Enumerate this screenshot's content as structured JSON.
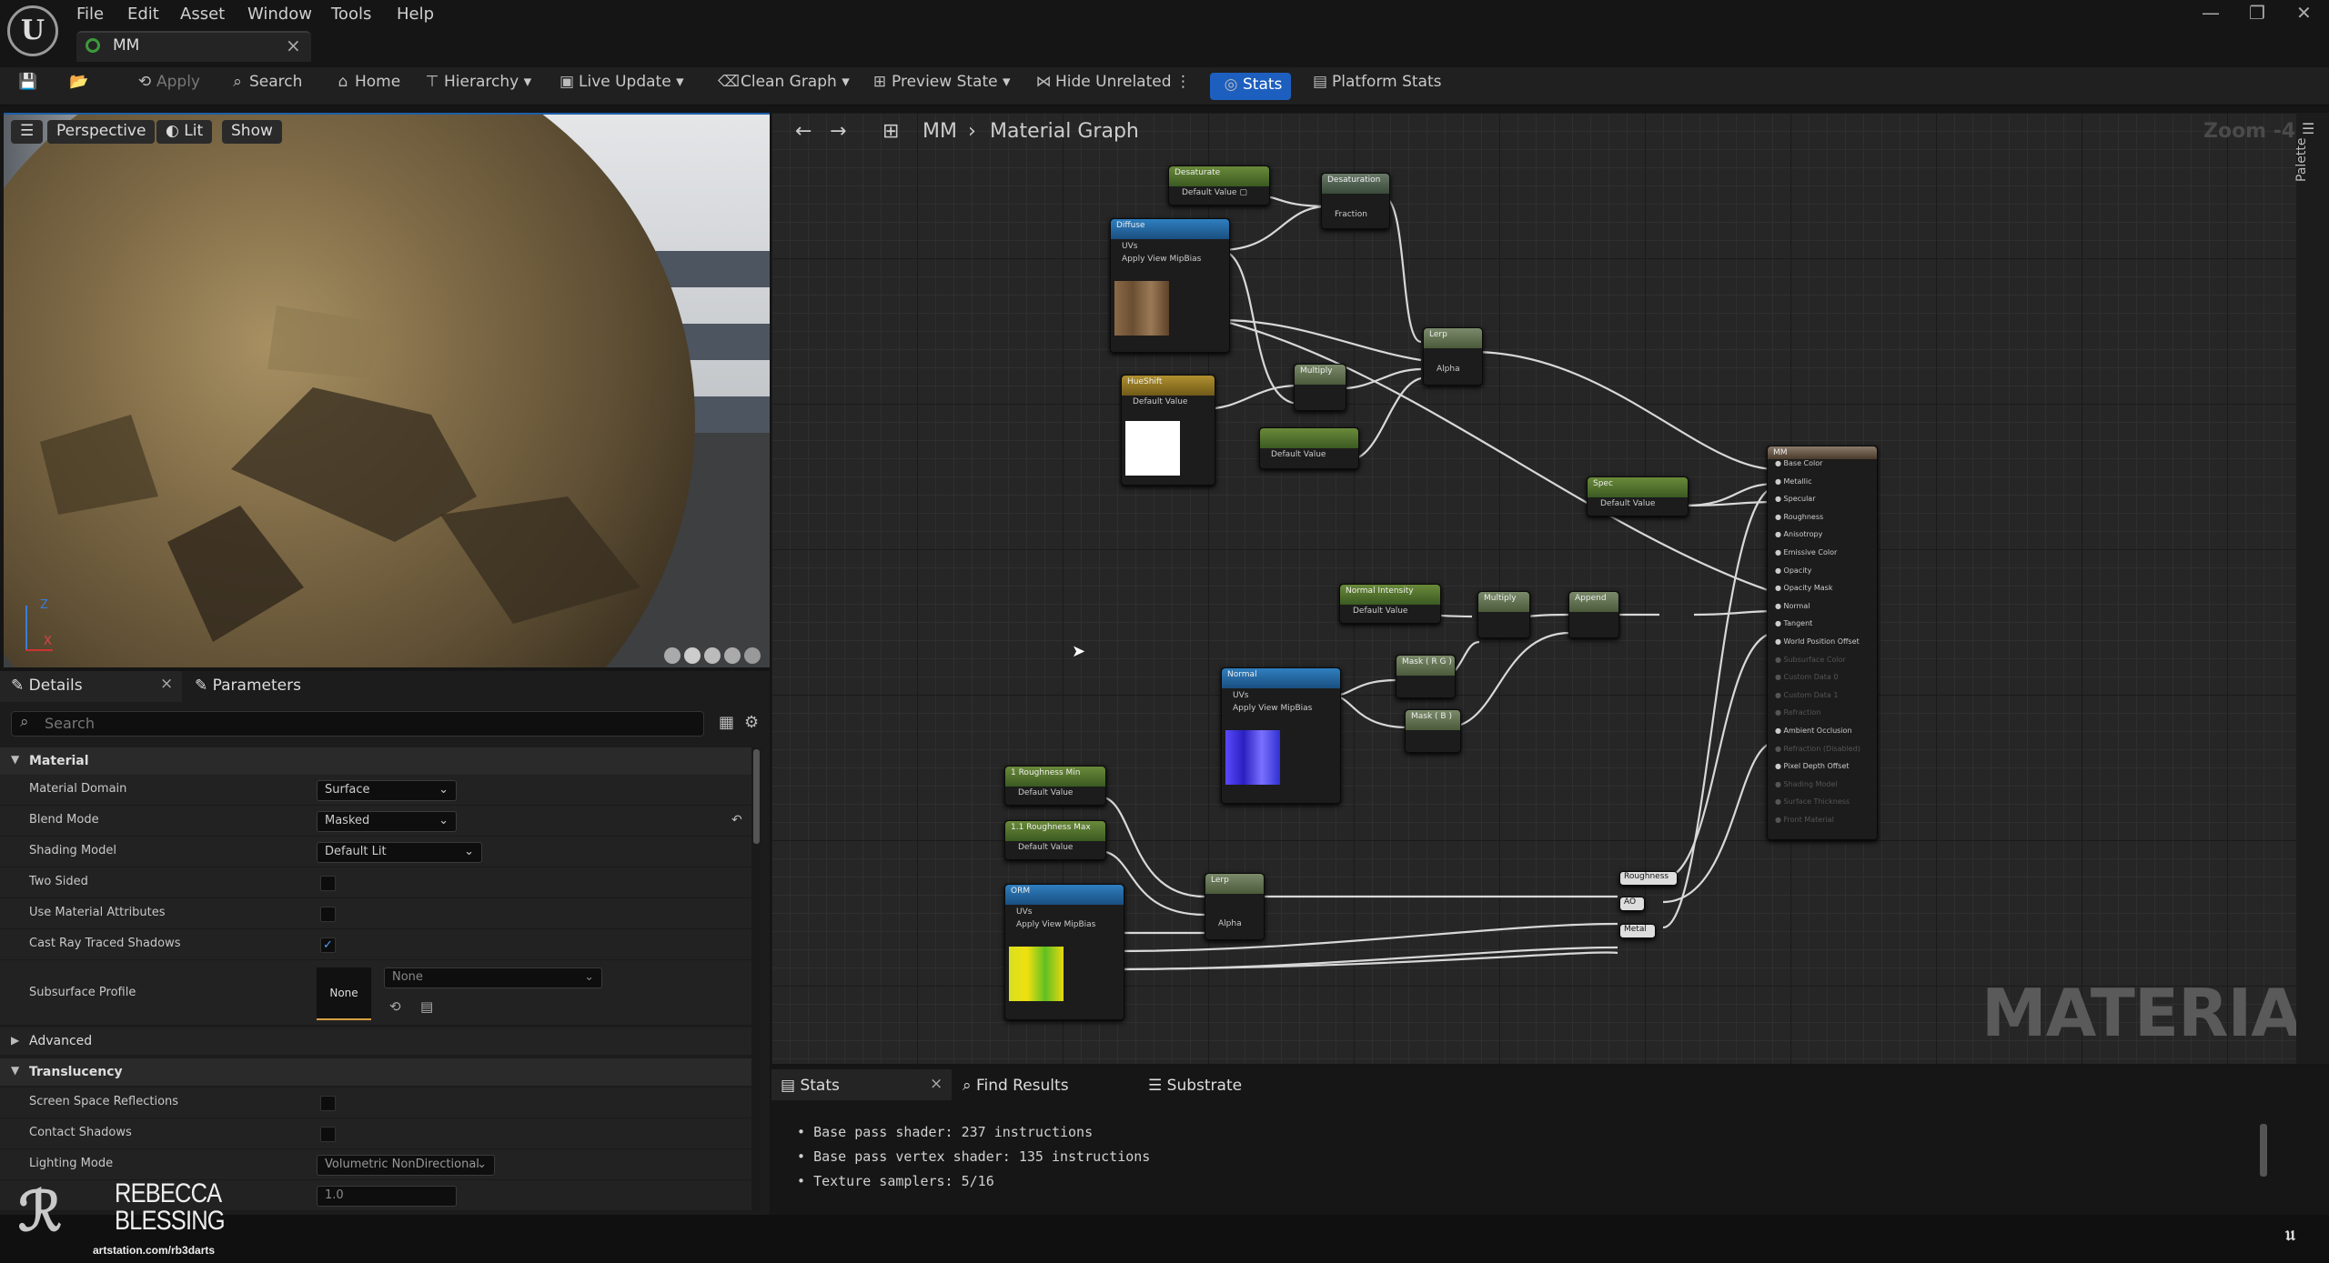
{
  "menu": {
    "logo": "U",
    "items": [
      "File",
      "Edit",
      "Asset",
      "Window",
      "Tools",
      "Help"
    ]
  },
  "tab": {
    "title": "MM",
    "close": "×"
  },
  "toolbar": {
    "apply": "Apply",
    "search": "Search",
    "home": "Home",
    "hierarchy": "Hierarchy",
    "live_update": "Live Update",
    "clean_graph": "Clean Graph",
    "preview_state": "Preview State",
    "hide_unrelated": "Hide Unrelated",
    "stats": "Stats",
    "platform_stats": "Platform Stats"
  },
  "viewport": {
    "perspective": "Perspective",
    "lit": "Lit",
    "show": "Show",
    "axis_z": "Z",
    "axis_x": "X"
  },
  "details": {
    "tab_details": "Details",
    "tab_parameters": "Parameters",
    "search_placeholder": "Search",
    "section_material": "Material",
    "material_domain_label": "Material Domain",
    "material_domain": "Surface",
    "blend_mode_label": "Blend Mode",
    "blend_mode": "Masked",
    "shading_model_label": "Shading Model",
    "shading_model": "Default Lit",
    "two_sided_label": "Two Sided",
    "use_material_attributes_label": "Use Material Attributes",
    "cast_ray_traced_shadows_label": "Cast Ray Traced Shadows",
    "subsurface_profile_label": "Subsurface Profile",
    "subsurface_thumb": "None",
    "subsurface_value": "None",
    "section_advanced": "Advanced",
    "section_translucency": "Translucency",
    "ssr_label": "Screen Space Reflections",
    "contact_shadows_label": "Contact Shadows",
    "lighting_mode_label": "Lighting Mode",
    "lighting_mode": "Volumetric NonDirectional",
    "partial_value": "1.0"
  },
  "graph": {
    "breadcrumb_root": "MM",
    "breadcrumb_current": "Material Graph",
    "zoom": "Zoom -4",
    "watermark": "MATERIAL",
    "palette": "Palette",
    "nodes": {
      "desaturate_param": "Desaturate",
      "desaturation": "Desaturation",
      "fraction": "Fraction",
      "diffuse": "Diffuse",
      "uvs": "UVs",
      "apply_view_mipbias": "Apply View MipBias",
      "lerp": "Lerp",
      "alpha": "Alpha",
      "multiply": "Multiply",
      "hueshift": "HueShift",
      "default_value": "Default Value",
      "specular_param": "Spec",
      "normal_intensity": "Normal Intensity",
      "append": "Append",
      "normal": "Normal",
      "mask_rg": "Mask ( R G )",
      "mask_b": "Mask ( B )",
      "roughness_min": "1 Roughness Min",
      "roughness_max": "1.1 Roughness Max",
      "orm": "ORM",
      "reroute_roughness": "Roughness",
      "reroute_ao": "AO",
      "reroute_metal": "Metal",
      "output_title": "MM",
      "output_pins": [
        "Base Color",
        "Metallic",
        "Specular",
        "Roughness",
        "Anisotropy",
        "Emissive Color",
        "Opacity",
        "Opacity Mask",
        "Normal",
        "Tangent",
        "World Position Offset",
        "Subsurface Color",
        "Custom Data 0",
        "Custom Data 1",
        "Refraction",
        "Ambient Occlusion",
        "Refraction (Disabled)",
        "Pixel Depth Offset",
        "Shading Model",
        "Surface Thickness",
        "Front Material"
      ]
    }
  },
  "stats": {
    "tab_stats": "Stats",
    "tab_find": "Find Results",
    "tab_substrate": "Substrate",
    "lines": [
      "Base pass shader: 237 instructions",
      "Base pass vertex shader: 135 instructions",
      "Texture samplers: 5/16"
    ]
  },
  "branding": {
    "name_line1": "REBECCA",
    "name_line2": "BLESSING",
    "url": "artstation.com/rb3darts"
  }
}
